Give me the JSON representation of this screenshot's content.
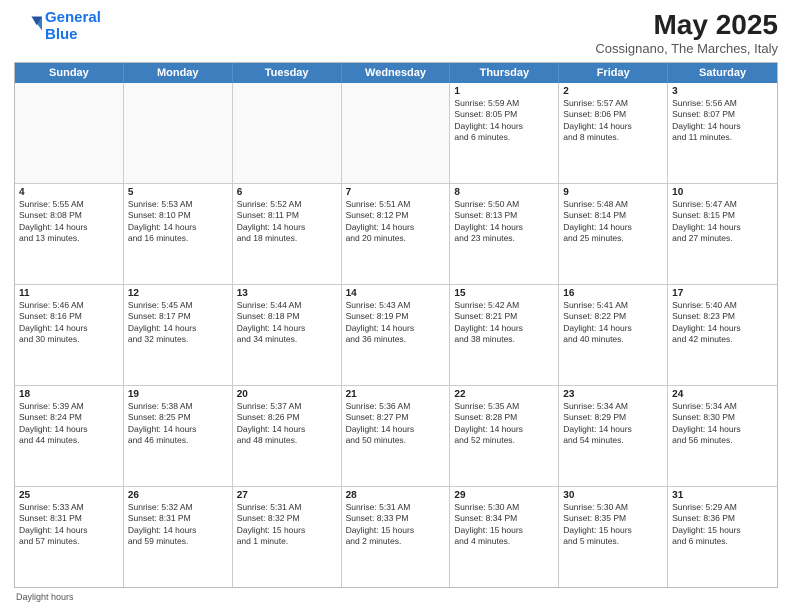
{
  "header": {
    "logo_line1": "General",
    "logo_line2": "Blue",
    "main_title": "May 2025",
    "subtitle": "Cossignano, The Marches, Italy"
  },
  "day_headers": [
    "Sunday",
    "Monday",
    "Tuesday",
    "Wednesday",
    "Thursday",
    "Friday",
    "Saturday"
  ],
  "weeks": [
    [
      {
        "num": "",
        "info": ""
      },
      {
        "num": "",
        "info": ""
      },
      {
        "num": "",
        "info": ""
      },
      {
        "num": "",
        "info": ""
      },
      {
        "num": "1",
        "info": "Sunrise: 5:59 AM\nSunset: 8:05 PM\nDaylight: 14 hours\nand 6 minutes."
      },
      {
        "num": "2",
        "info": "Sunrise: 5:57 AM\nSunset: 8:06 PM\nDaylight: 14 hours\nand 8 minutes."
      },
      {
        "num": "3",
        "info": "Sunrise: 5:56 AM\nSunset: 8:07 PM\nDaylight: 14 hours\nand 11 minutes."
      }
    ],
    [
      {
        "num": "4",
        "info": "Sunrise: 5:55 AM\nSunset: 8:08 PM\nDaylight: 14 hours\nand 13 minutes."
      },
      {
        "num": "5",
        "info": "Sunrise: 5:53 AM\nSunset: 8:10 PM\nDaylight: 14 hours\nand 16 minutes."
      },
      {
        "num": "6",
        "info": "Sunrise: 5:52 AM\nSunset: 8:11 PM\nDaylight: 14 hours\nand 18 minutes."
      },
      {
        "num": "7",
        "info": "Sunrise: 5:51 AM\nSunset: 8:12 PM\nDaylight: 14 hours\nand 20 minutes."
      },
      {
        "num": "8",
        "info": "Sunrise: 5:50 AM\nSunset: 8:13 PM\nDaylight: 14 hours\nand 23 minutes."
      },
      {
        "num": "9",
        "info": "Sunrise: 5:48 AM\nSunset: 8:14 PM\nDaylight: 14 hours\nand 25 minutes."
      },
      {
        "num": "10",
        "info": "Sunrise: 5:47 AM\nSunset: 8:15 PM\nDaylight: 14 hours\nand 27 minutes."
      }
    ],
    [
      {
        "num": "11",
        "info": "Sunrise: 5:46 AM\nSunset: 8:16 PM\nDaylight: 14 hours\nand 30 minutes."
      },
      {
        "num": "12",
        "info": "Sunrise: 5:45 AM\nSunset: 8:17 PM\nDaylight: 14 hours\nand 32 minutes."
      },
      {
        "num": "13",
        "info": "Sunrise: 5:44 AM\nSunset: 8:18 PM\nDaylight: 14 hours\nand 34 minutes."
      },
      {
        "num": "14",
        "info": "Sunrise: 5:43 AM\nSunset: 8:19 PM\nDaylight: 14 hours\nand 36 minutes."
      },
      {
        "num": "15",
        "info": "Sunrise: 5:42 AM\nSunset: 8:21 PM\nDaylight: 14 hours\nand 38 minutes."
      },
      {
        "num": "16",
        "info": "Sunrise: 5:41 AM\nSunset: 8:22 PM\nDaylight: 14 hours\nand 40 minutes."
      },
      {
        "num": "17",
        "info": "Sunrise: 5:40 AM\nSunset: 8:23 PM\nDaylight: 14 hours\nand 42 minutes."
      }
    ],
    [
      {
        "num": "18",
        "info": "Sunrise: 5:39 AM\nSunset: 8:24 PM\nDaylight: 14 hours\nand 44 minutes."
      },
      {
        "num": "19",
        "info": "Sunrise: 5:38 AM\nSunset: 8:25 PM\nDaylight: 14 hours\nand 46 minutes."
      },
      {
        "num": "20",
        "info": "Sunrise: 5:37 AM\nSunset: 8:26 PM\nDaylight: 14 hours\nand 48 minutes."
      },
      {
        "num": "21",
        "info": "Sunrise: 5:36 AM\nSunset: 8:27 PM\nDaylight: 14 hours\nand 50 minutes."
      },
      {
        "num": "22",
        "info": "Sunrise: 5:35 AM\nSunset: 8:28 PM\nDaylight: 14 hours\nand 52 minutes."
      },
      {
        "num": "23",
        "info": "Sunrise: 5:34 AM\nSunset: 8:29 PM\nDaylight: 14 hours\nand 54 minutes."
      },
      {
        "num": "24",
        "info": "Sunrise: 5:34 AM\nSunset: 8:30 PM\nDaylight: 14 hours\nand 56 minutes."
      }
    ],
    [
      {
        "num": "25",
        "info": "Sunrise: 5:33 AM\nSunset: 8:31 PM\nDaylight: 14 hours\nand 57 minutes."
      },
      {
        "num": "26",
        "info": "Sunrise: 5:32 AM\nSunset: 8:31 PM\nDaylight: 14 hours\nand 59 minutes."
      },
      {
        "num": "27",
        "info": "Sunrise: 5:31 AM\nSunset: 8:32 PM\nDaylight: 15 hours\nand 1 minute."
      },
      {
        "num": "28",
        "info": "Sunrise: 5:31 AM\nSunset: 8:33 PM\nDaylight: 15 hours\nand 2 minutes."
      },
      {
        "num": "29",
        "info": "Sunrise: 5:30 AM\nSunset: 8:34 PM\nDaylight: 15 hours\nand 4 minutes."
      },
      {
        "num": "30",
        "info": "Sunrise: 5:30 AM\nSunset: 8:35 PM\nDaylight: 15 hours\nand 5 minutes."
      },
      {
        "num": "31",
        "info": "Sunrise: 5:29 AM\nSunset: 8:36 PM\nDaylight: 15 hours\nand 6 minutes."
      }
    ]
  ],
  "footer": {
    "daylight_label": "Daylight hours"
  }
}
